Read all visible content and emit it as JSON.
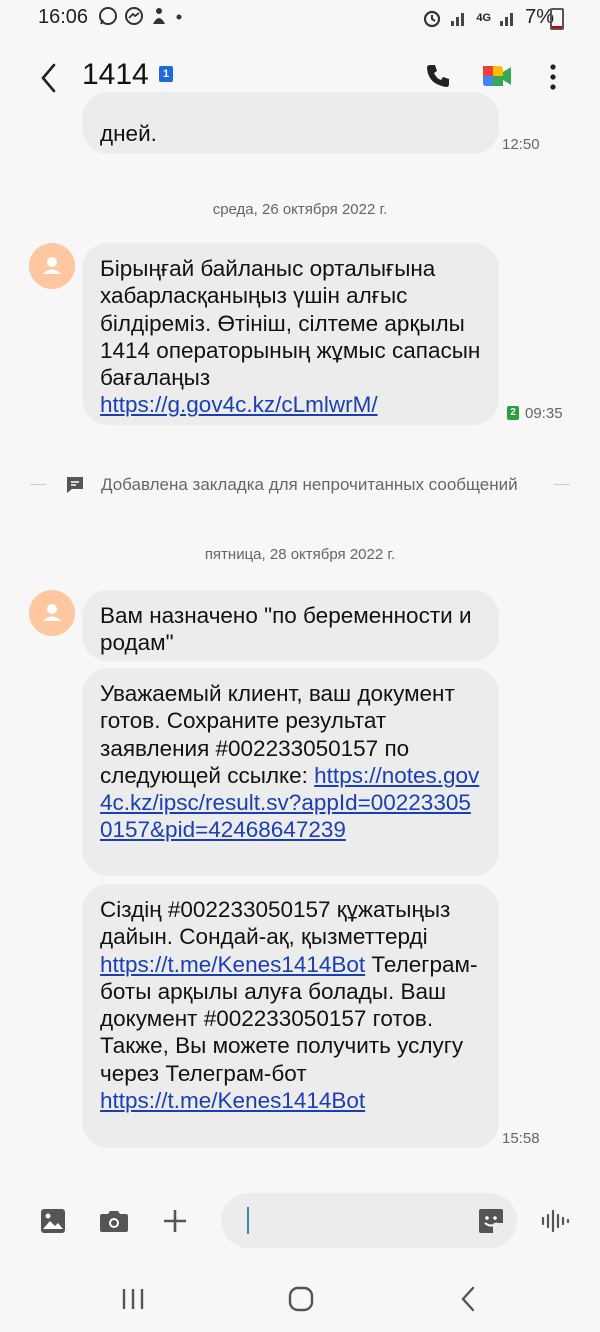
{
  "status_bar": {
    "time": "16:06",
    "battery": "7%",
    "network": "4G"
  },
  "header": {
    "title": "1414",
    "sim_badge": "1"
  },
  "messages": {
    "m0_text": "дней.",
    "m0_time": "12:50",
    "date1": "среда, 26 октября 2022 г.",
    "m1_text": "Бірыңғай байланыс орталығына хабарласқаныңыз үшін алғыс білдіреміз. Өтініш, сілтеме арқылы 1414 операторының жұмыс сапасын бағалаңыз ",
    "m1_link": "https://g.gov4c.kz/cLmlwrM/",
    "m1_sim": "2",
    "m1_time": "09:35",
    "bookmark": "Добавлена закладка для непрочитанных сообщений",
    "date2": "пятница, 28 октября 2022 г.",
    "m2_text": "Вам назначено \"по беременности и родам\"",
    "m3_text": "Уважаемый клиент, ваш документ готов. Сохраните результат заявления #002233050157 по следующей ссылке: ",
    "m3_link": "https://notes.gov4c.kz/ipsc/result.sv?appId=002233050157&pid=42468647239",
    "m4_text_a": "Сіздің  #002233050157 құжатыңыз дайын. Сондай-ақ, қызметтерді ",
    "m4_link_a": "https://t.me/Kenes1414Bot",
    "m4_text_b": " Телеграм-боты арқылы алуға болады. Ваш документ #002233050157 готов. Также, Вы можете получить услугу через Телеграм-бот ",
    "m4_link_b": "https://t.me/Kenes1414Bot",
    "m4_time": "15:58"
  },
  "composer": {
    "placeholder": ""
  },
  "icons": [
    "back-icon",
    "call-icon",
    "video-call-icon",
    "more-icon",
    "avatar-icon",
    "bookmark-icon",
    "gallery-icon",
    "camera-icon",
    "add-icon",
    "sticker-icon",
    "voice-icon",
    "recents-icon",
    "home-icon",
    "nav-back-icon"
  ],
  "colors": {
    "link": "#1a3fb4",
    "avatar": "#ffc79f",
    "sim_badge": "#1d6ad8",
    "sim2_badge": "#2c9f3c",
    "bubble": "#ececec"
  }
}
